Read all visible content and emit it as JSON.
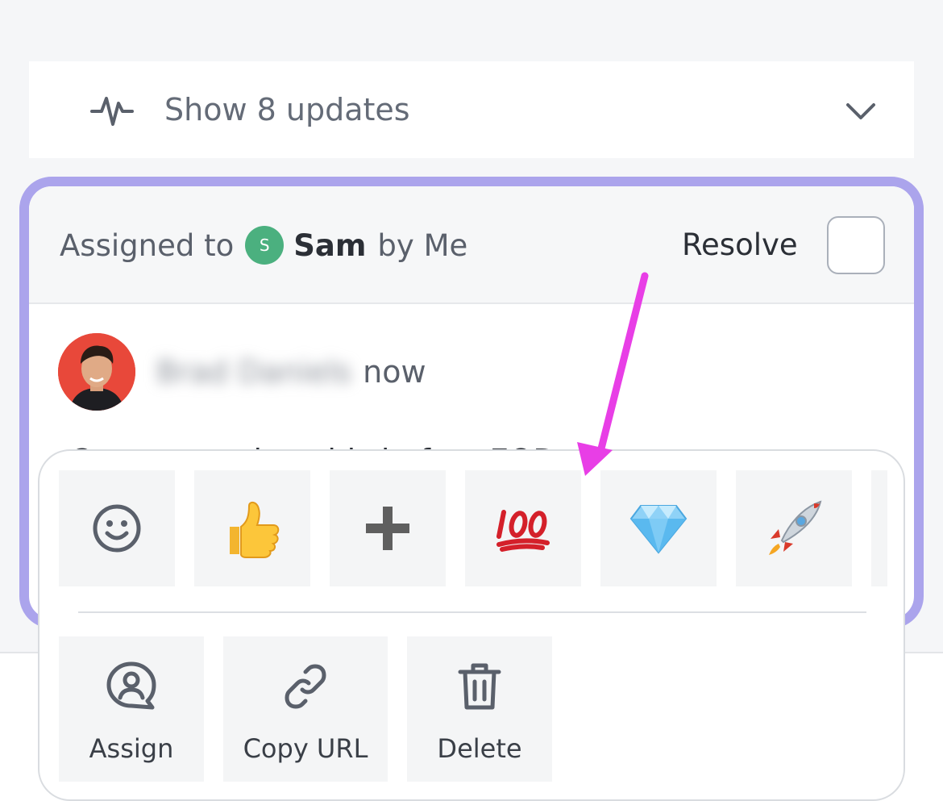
{
  "updates": {
    "label": "Show 8 updates",
    "icon": "activity-icon",
    "toggle_icon": "chevron-down-icon"
  },
  "card": {
    "assigned_prefix": "Assigned to",
    "assignee_initial": "S",
    "assignee": "Sam",
    "assigned_by": "by Me",
    "resolve_label": "Resolve",
    "author_name": "Brad Daniels",
    "author_time": "now",
    "comment_text": "Can you review this before EOD"
  },
  "reactions": [
    {
      "name": "add-reaction",
      "icon": "smiley-icon"
    },
    {
      "name": "thumbs-up",
      "glyph": "👍"
    },
    {
      "name": "plus",
      "icon": "plus-icon"
    },
    {
      "name": "hundred",
      "glyph": "💯"
    },
    {
      "name": "gem",
      "glyph": "💎"
    },
    {
      "name": "rocket",
      "glyph": "🚀"
    }
  ],
  "actions": {
    "assign": "Assign",
    "copy_url": "Copy URL",
    "delete": "Delete"
  },
  "colors": {
    "card_border": "#aba4ec",
    "annotation_arrow": "#e83ee6",
    "assignee_avatar": "#4bb07f"
  }
}
